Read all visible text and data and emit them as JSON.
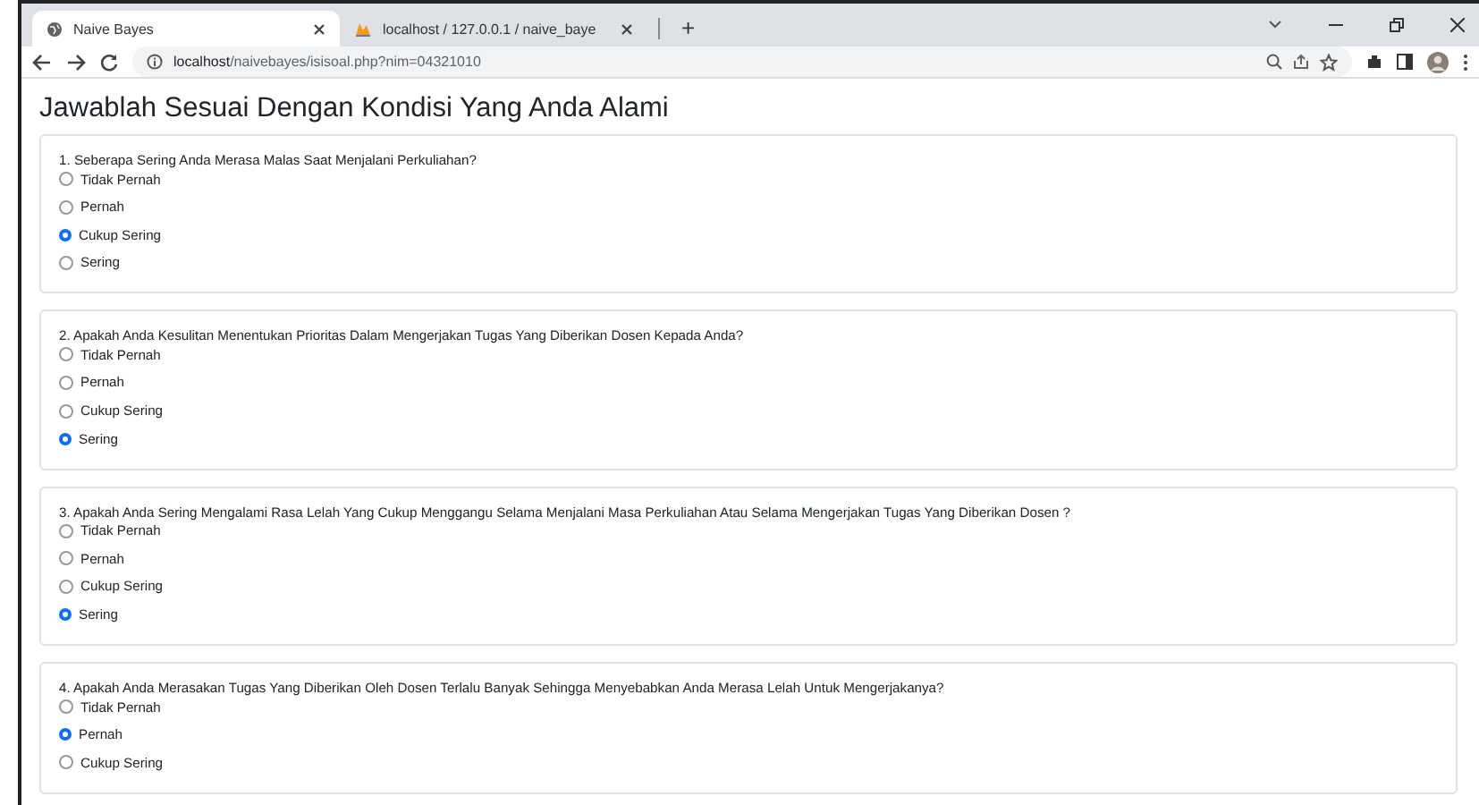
{
  "browser": {
    "tabs": [
      {
        "title": "Naive Bayes",
        "selected": true
      },
      {
        "title": "localhost / 127.0.0.1 / naive_baye",
        "selected": false
      }
    ],
    "new_tab": "+",
    "address": {
      "host": "localhost",
      "path": "/naivebayes/isisoal.php?nim=04321010"
    }
  },
  "page": {
    "heading": "Jawablah Sesuai Dengan Kondisi Yang Anda Alami",
    "questions": [
      {
        "text": "1. Seberapa Sering Anda Merasa Malas Saat Menjalani Perkuliahan?",
        "options": [
          {
            "label": "Tidak Pernah",
            "selected": false
          },
          {
            "label": "Pernah",
            "selected": false
          },
          {
            "label": "Cukup Sering",
            "selected": true
          },
          {
            "label": "Sering",
            "selected": false
          }
        ]
      },
      {
        "text": "2. Apakah Anda Kesulitan Menentukan Prioritas Dalam Mengerjakan Tugas Yang Diberikan Dosen Kepada Anda?",
        "options": [
          {
            "label": "Tidak Pernah",
            "selected": false
          },
          {
            "label": "Pernah",
            "selected": false
          },
          {
            "label": "Cukup Sering",
            "selected": false
          },
          {
            "label": "Sering",
            "selected": true
          }
        ]
      },
      {
        "text": "3. Apakah Anda Sering Mengalami Rasa Lelah Yang Cukup Menggangu Selama Menjalani Masa Perkuliahan Atau Selama Mengerjakan Tugas Yang Diberikan Dosen ?",
        "options": [
          {
            "label": "Tidak Pernah",
            "selected": false
          },
          {
            "label": "Pernah",
            "selected": false
          },
          {
            "label": "Cukup Sering",
            "selected": false
          },
          {
            "label": "Sering",
            "selected": true
          }
        ]
      },
      {
        "text": "4. Apakah Anda Merasakan Tugas Yang Diberikan Oleh Dosen Terlalu Banyak Sehingga Menyebabkan Anda Merasa Lelah Untuk Mengerjakanya?",
        "options": [
          {
            "label": "Tidak Pernah",
            "selected": false
          },
          {
            "label": "Pernah",
            "selected": true
          },
          {
            "label": "Cukup Sering",
            "selected": false
          }
        ]
      }
    ]
  }
}
